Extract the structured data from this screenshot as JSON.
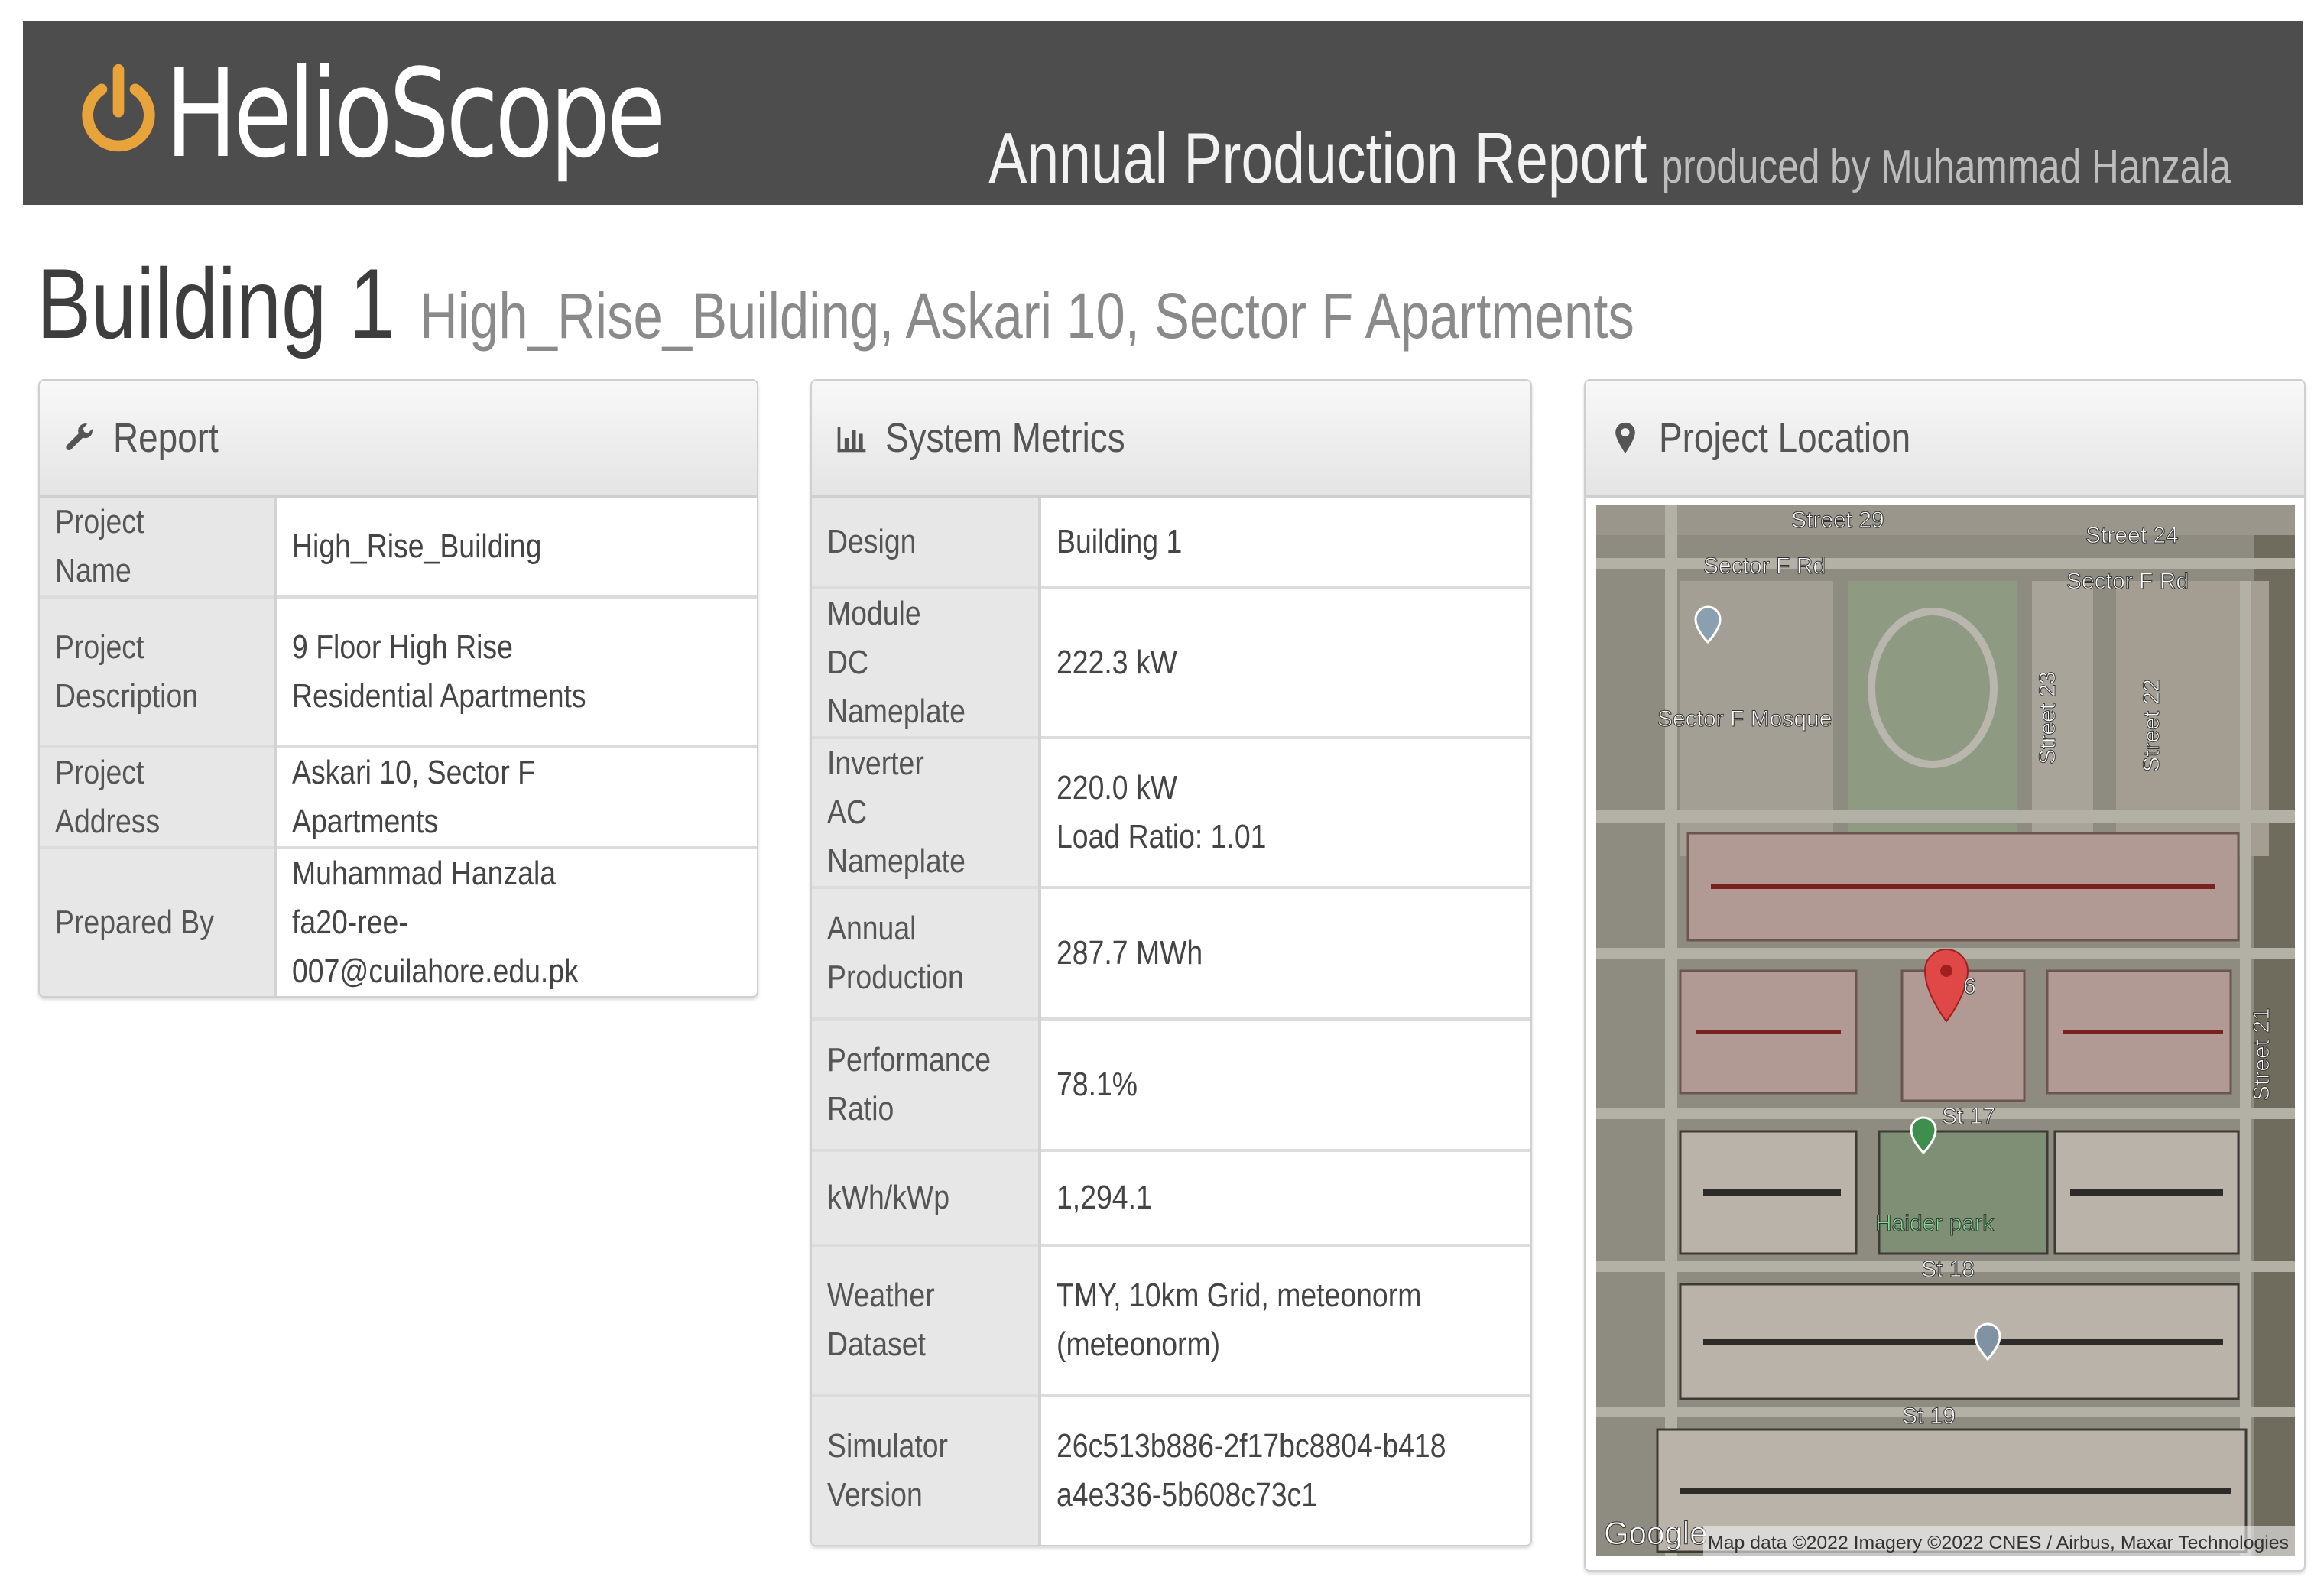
{
  "header": {
    "brand": "HelioScope",
    "report_title": "Annual Production Report",
    "produced_by": "produced by Muhammad Hanzala",
    "brand_color": "#e8a33a"
  },
  "page": {
    "design_name": "Building 1",
    "design_description": "High_Rise_Building, Askari 10, Sector F Apartments"
  },
  "report": {
    "title": "Report",
    "icon": "wrench-icon",
    "rows": [
      {
        "label": "Project Name",
        "value": "High_Rise_Building"
      },
      {
        "label": "Project Description",
        "value": "9 Floor High Rise Residential Apartments"
      },
      {
        "label": "Project Address",
        "value": "Askari 10, Sector F Apartments"
      },
      {
        "label": "Prepared By",
        "value": "Muhammad Hanzala",
        "value2": "fa20-ree-007@cuilahore.edu.pk"
      }
    ]
  },
  "metrics": {
    "title": "System Metrics",
    "icon": "bar-chart-icon",
    "rows": [
      {
        "label": "Design",
        "value": "Building 1"
      },
      {
        "label": "Module DC Nameplate",
        "value": "222.3 kW"
      },
      {
        "label": "Inverter AC Nameplate",
        "value": "220.0 kW",
        "value2": "Load Ratio: 1.01"
      },
      {
        "label": "Annual Production",
        "value": "287.7 MWh"
      },
      {
        "label": "Performance Ratio",
        "value": "78.1%"
      },
      {
        "label": "kWh/kWp",
        "value": "1,294.1"
      },
      {
        "label": "Weather Dataset",
        "value": "TMY, 10km Grid, meteonorm (meteonorm)"
      },
      {
        "label": "Simulator Version",
        "value": "26c513b886-2f17bc8804-b418a4e336-5b608c73c1"
      }
    ]
  },
  "location": {
    "title": "Project Location",
    "icon": "map-pin-icon",
    "map_labels": {
      "street29": "Street 29",
      "street24": "Street 24",
      "sector_rd_left": "Sector F Rd",
      "sector_rd_right": "Sector F Rd",
      "street23": "Street 23",
      "street22": "Street 22",
      "street21": "Street 21",
      "mosque": "Sector F Mosque",
      "st16": "6",
      "st17": "St 17",
      "park": "Haider park",
      "st18": "St 18",
      "st19": "St 19",
      "google": "Google",
      "attribution": "Map data ©2022 Imagery ©2022 CNES / Airbus, Maxar Technologies"
    }
  }
}
